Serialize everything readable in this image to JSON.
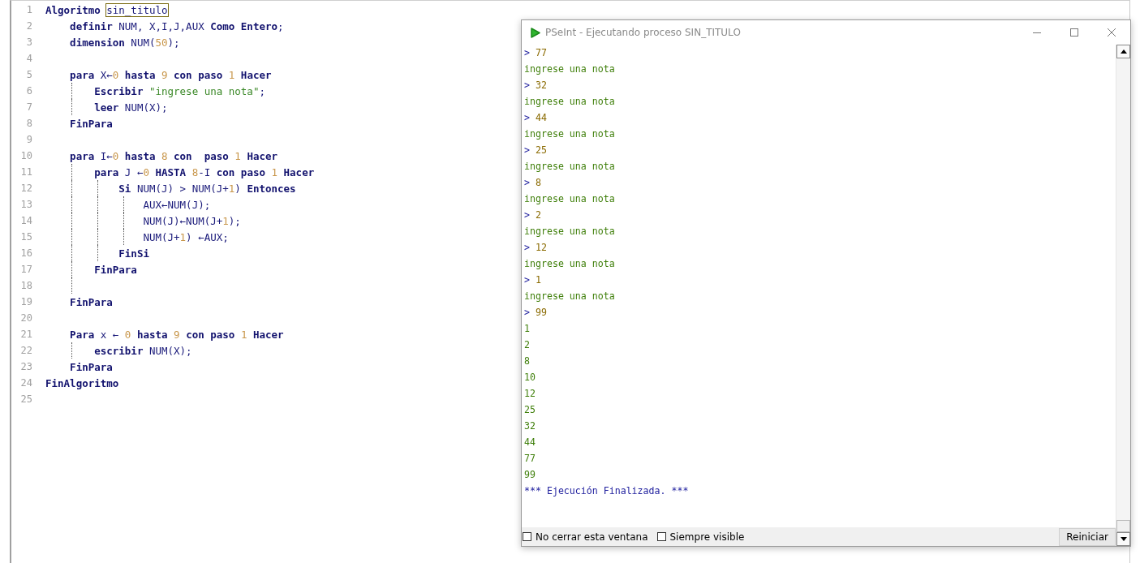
{
  "editor": {
    "lines": [
      {
        "number": "1",
        "tokens": [
          {
            "kind": "kw",
            "text": "Algoritmo "
          },
          {
            "kind": "id",
            "text": "sin_titulo",
            "highlighted": true
          }
        ]
      },
      {
        "number": "2",
        "tokens": [
          {
            "kind": "kw",
            "text": "    definir"
          },
          {
            "kind": "id",
            "text": " NUM, X,I,J,AUX "
          },
          {
            "kind": "kw",
            "text": "Como Entero"
          },
          {
            "kind": "id",
            "text": ";"
          }
        ]
      },
      {
        "number": "3",
        "tokens": [
          {
            "kind": "kw",
            "text": "    dimension"
          },
          {
            "kind": "id",
            "text": " NUM("
          },
          {
            "kind": "num",
            "text": "50"
          },
          {
            "kind": "id",
            "text": ");"
          }
        ]
      },
      {
        "number": "4"
      },
      {
        "number": "5",
        "tokens": [
          {
            "kind": "kw",
            "text": "    para"
          },
          {
            "kind": "id",
            "text": " X←"
          },
          {
            "kind": "num",
            "text": "0"
          },
          {
            "kind": "kw",
            "text": " hasta "
          },
          {
            "kind": "num",
            "text": "9"
          },
          {
            "kind": "kw",
            "text": " con paso "
          },
          {
            "kind": "num",
            "text": "1"
          },
          {
            "kind": "kw",
            "text": " Hacer"
          }
        ]
      },
      {
        "number": "6",
        "tokens": [
          {
            "kind": "kw",
            "text": "        Escribir "
          },
          {
            "kind": "str",
            "text": "\"ingrese una nota\""
          },
          {
            "kind": "id",
            "text": ";"
          }
        ]
      },
      {
        "number": "7",
        "tokens": [
          {
            "kind": "kw",
            "text": "        leer"
          },
          {
            "kind": "id",
            "text": " NUM(X);"
          }
        ]
      },
      {
        "number": "8",
        "tokens": [
          {
            "kind": "kw",
            "text": "    FinPara"
          }
        ]
      },
      {
        "number": "9"
      },
      {
        "number": "10",
        "tokens": [
          {
            "kind": "kw",
            "text": "    para"
          },
          {
            "kind": "id",
            "text": " I←"
          },
          {
            "kind": "num",
            "text": "0"
          },
          {
            "kind": "kw",
            "text": " hasta "
          },
          {
            "kind": "num",
            "text": "8"
          },
          {
            "kind": "kw",
            "text": " con  paso "
          },
          {
            "kind": "num",
            "text": "1"
          },
          {
            "kind": "kw",
            "text": " Hacer"
          }
        ]
      },
      {
        "number": "11",
        "tokens": [
          {
            "kind": "kw",
            "text": "        para"
          },
          {
            "kind": "id",
            "text": " J ←"
          },
          {
            "kind": "num",
            "text": "0"
          },
          {
            "kind": "kw",
            "text": " HASTA "
          },
          {
            "kind": "num",
            "text": "8"
          },
          {
            "kind": "id",
            "text": "-I "
          },
          {
            "kind": "kw",
            "text": "con paso "
          },
          {
            "kind": "num",
            "text": "1"
          },
          {
            "kind": "kw",
            "text": " Hacer"
          }
        ]
      },
      {
        "number": "12",
        "tokens": [
          {
            "kind": "kw",
            "text": "            Si"
          },
          {
            "kind": "id",
            "text": " NUM(J) > NUM(J+"
          },
          {
            "kind": "num",
            "text": "1"
          },
          {
            "kind": "id",
            "text": ") "
          },
          {
            "kind": "kw",
            "text": "Entonces"
          }
        ]
      },
      {
        "number": "13",
        "tokens": [
          {
            "kind": "id",
            "text": "                AUX←NUM(J);"
          }
        ]
      },
      {
        "number": "14",
        "tokens": [
          {
            "kind": "id",
            "text": "                NUM(J)←NUM(J+"
          },
          {
            "kind": "num",
            "text": "1"
          },
          {
            "kind": "id",
            "text": ");"
          }
        ]
      },
      {
        "number": "15",
        "tokens": [
          {
            "kind": "id",
            "text": "                NUM(J+"
          },
          {
            "kind": "num",
            "text": "1"
          },
          {
            "kind": "id",
            "text": ") ←AUX;"
          }
        ]
      },
      {
        "number": "16",
        "tokens": [
          {
            "kind": "kw",
            "text": "            FinSi"
          }
        ]
      },
      {
        "number": "17",
        "tokens": [
          {
            "kind": "kw",
            "text": "        FinPara"
          }
        ]
      },
      {
        "number": "18"
      },
      {
        "number": "19",
        "tokens": [
          {
            "kind": "kw",
            "text": "    FinPara"
          }
        ]
      },
      {
        "number": "20"
      },
      {
        "number": "21",
        "tokens": [
          {
            "kind": "kw",
            "text": "    Para"
          },
          {
            "kind": "id",
            "text": " x ← "
          },
          {
            "kind": "num",
            "text": "0"
          },
          {
            "kind": "kw",
            "text": " hasta "
          },
          {
            "kind": "num",
            "text": "9"
          },
          {
            "kind": "kw",
            "text": " con paso "
          },
          {
            "kind": "num",
            "text": "1"
          },
          {
            "kind": "kw",
            "text": " Hacer"
          }
        ]
      },
      {
        "number": "22",
        "tokens": [
          {
            "kind": "kw",
            "text": "        escribir"
          },
          {
            "kind": "id",
            "text": " NUM(X);"
          }
        ]
      },
      {
        "number": "23",
        "tokens": [
          {
            "kind": "kw",
            "text": "    FinPara"
          }
        ]
      },
      {
        "number": "24",
        "tokens": [
          {
            "kind": "kw",
            "text": "FinAlgoritmo"
          }
        ]
      },
      {
        "number": "25"
      }
    ]
  },
  "console": {
    "title": "PSeInt - Ejecutando proceso SIN_TITULO",
    "lines": [
      {
        "kind": "input",
        "prompt": ">",
        "text": "77"
      },
      {
        "kind": "output",
        "text": "ingrese una nota"
      },
      {
        "kind": "input",
        "prompt": ">",
        "text": "32"
      },
      {
        "kind": "output",
        "text": "ingrese una nota"
      },
      {
        "kind": "input",
        "prompt": ">",
        "text": "44"
      },
      {
        "kind": "output",
        "text": "ingrese una nota"
      },
      {
        "kind": "input",
        "prompt": ">",
        "text": "25"
      },
      {
        "kind": "output",
        "text": "ingrese una nota"
      },
      {
        "kind": "input",
        "prompt": ">",
        "text": "8"
      },
      {
        "kind": "output",
        "text": "ingrese una nota"
      },
      {
        "kind": "input",
        "prompt": ">",
        "text": "2"
      },
      {
        "kind": "output",
        "text": "ingrese una nota"
      },
      {
        "kind": "input",
        "prompt": ">",
        "text": "12"
      },
      {
        "kind": "output",
        "text": "ingrese una nota"
      },
      {
        "kind": "input",
        "prompt": ">",
        "text": "1"
      },
      {
        "kind": "output",
        "text": "ingrese una nota"
      },
      {
        "kind": "input",
        "prompt": ">",
        "text": "99"
      },
      {
        "kind": "output",
        "text": "1"
      },
      {
        "kind": "output",
        "text": "2"
      },
      {
        "kind": "output",
        "text": "8"
      },
      {
        "kind": "output",
        "text": "10"
      },
      {
        "kind": "output",
        "text": "12"
      },
      {
        "kind": "output",
        "text": "25"
      },
      {
        "kind": "output",
        "text": "32"
      },
      {
        "kind": "output",
        "text": "44"
      },
      {
        "kind": "output",
        "text": "77"
      },
      {
        "kind": "output",
        "text": "99"
      },
      {
        "kind": "end",
        "text": "*** Ejecución Finalizada. ***"
      }
    ],
    "options": [
      {
        "label": "No cerrar esta ventana",
        "checked": false
      },
      {
        "label": "Siempre visible",
        "checked": false
      }
    ],
    "button": "Reiniciar"
  }
}
